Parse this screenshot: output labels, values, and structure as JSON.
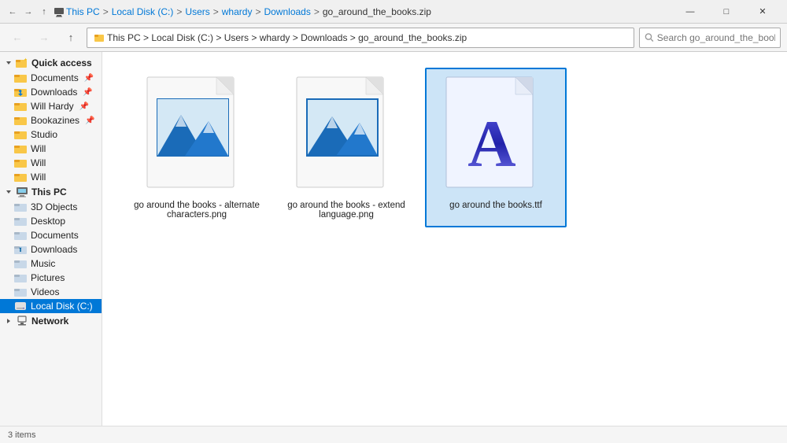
{
  "titlebar": {
    "back_disabled": true,
    "forward_disabled": true,
    "up_label": "Up",
    "path_parts": [
      "This PC",
      "Local Disk (C:)",
      "Users",
      "whardy",
      "Downloads",
      "go_around_the_books.zip"
    ],
    "window_title": "go_around_the_books.zip",
    "minimize": "—",
    "maximize": "□",
    "close": "✕"
  },
  "addressbar": {
    "search_placeholder": "Search go_around_the_books.zip"
  },
  "sidebar": {
    "quick_access_label": "Quick access",
    "items_quick": [
      {
        "label": "Documents",
        "pinned": true,
        "type": "folder"
      },
      {
        "label": "Downloads",
        "pinned": true,
        "type": "downloads"
      },
      {
        "label": "Will Hardy",
        "pinned": true,
        "type": "folder"
      },
      {
        "label": "Bookazines",
        "pinned": true,
        "type": "folder"
      },
      {
        "label": "Studio",
        "type": "folder"
      },
      {
        "label": "Will",
        "type": "folder"
      },
      {
        "label": "Will",
        "type": "folder"
      },
      {
        "label": "Will",
        "type": "folder"
      }
    ],
    "this_pc_label": "This PC",
    "items_pc": [
      {
        "label": "3D Objects",
        "type": "folder3d"
      },
      {
        "label": "Desktop",
        "type": "desktop"
      },
      {
        "label": "Documents",
        "type": "folder"
      },
      {
        "label": "Downloads",
        "type": "downloads"
      },
      {
        "label": "Music",
        "type": "music"
      },
      {
        "label": "Pictures",
        "type": "pictures"
      },
      {
        "label": "Videos",
        "type": "videos"
      },
      {
        "label": "Local Disk (C:)",
        "type": "disk",
        "active": true
      }
    ],
    "network_label": "Network"
  },
  "files": [
    {
      "name": "go around the books - alternate characters.png",
      "type": "png",
      "selected": false
    },
    {
      "name": "go around the books - extend language.png",
      "type": "png",
      "selected": false
    },
    {
      "name": "go around the books.ttf",
      "type": "ttf",
      "selected": true
    }
  ],
  "statusbar": {
    "text": "3 items"
  }
}
